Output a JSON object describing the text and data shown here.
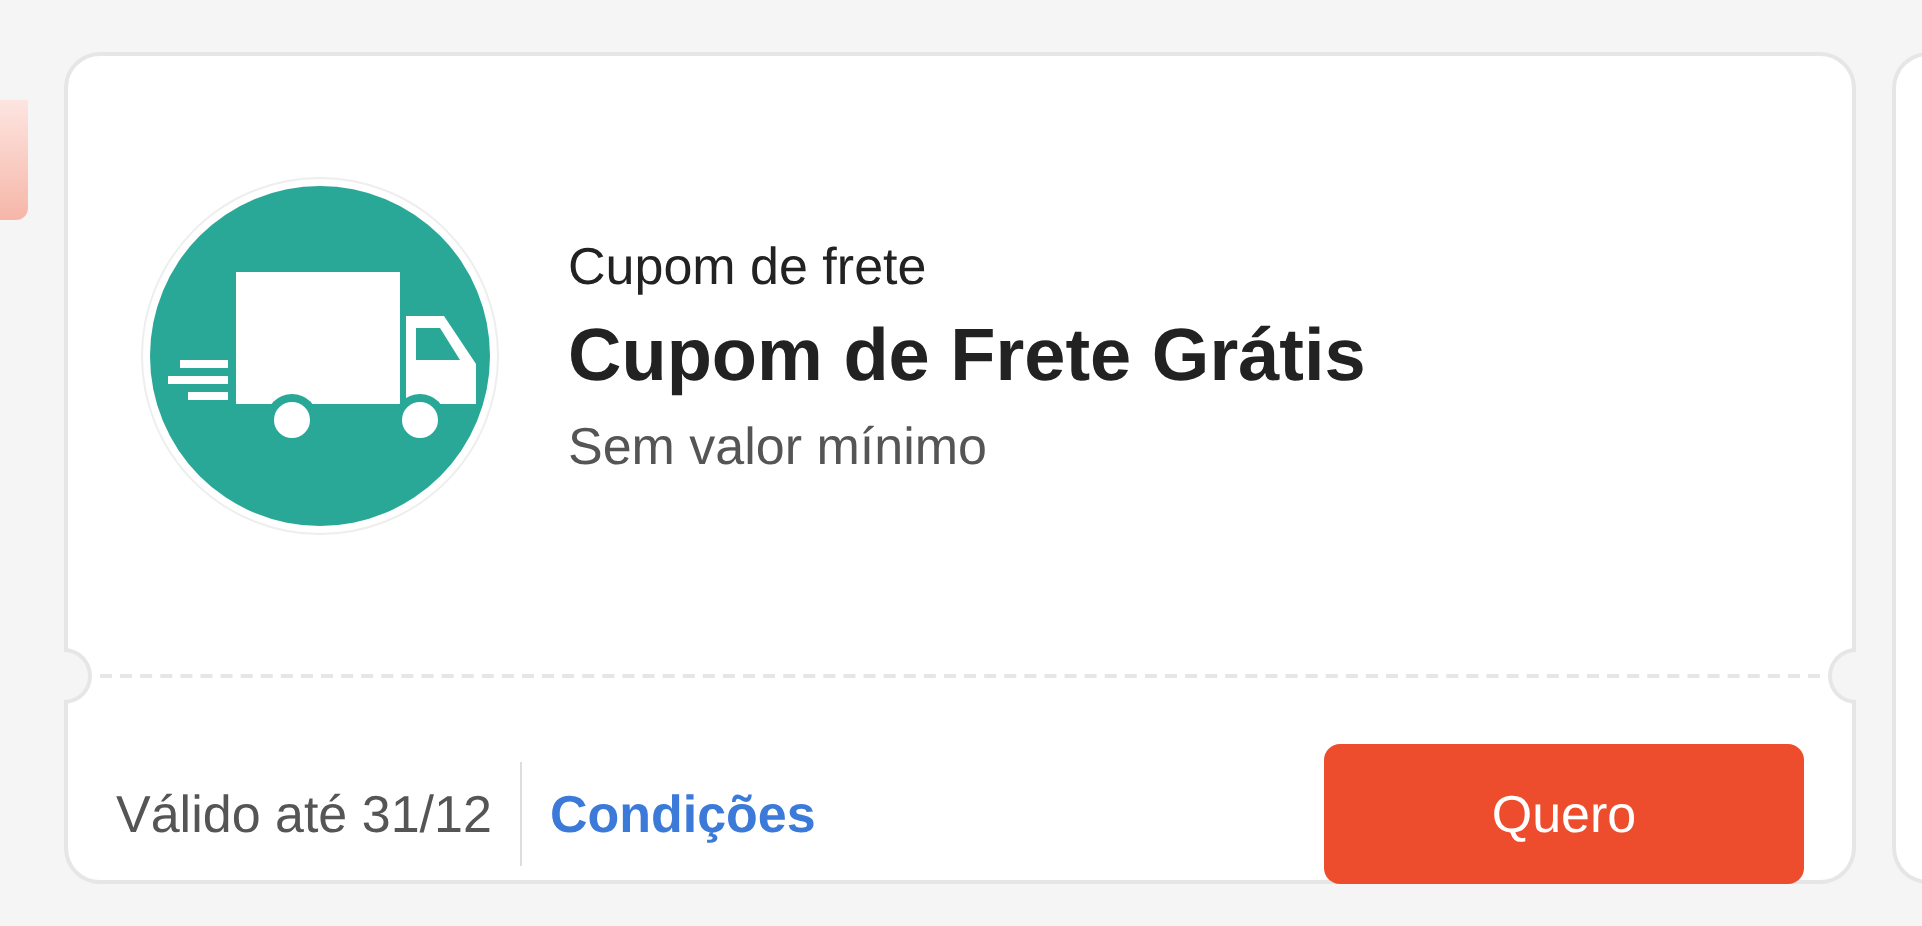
{
  "coupon": {
    "category": "Cupom de frete",
    "title": "Cupom de Frete Grátis",
    "subtitle": "Sem valor mínimo",
    "validity": "Válido até 31/12",
    "conditions_link": "Condições",
    "claim_button": "Quero"
  }
}
